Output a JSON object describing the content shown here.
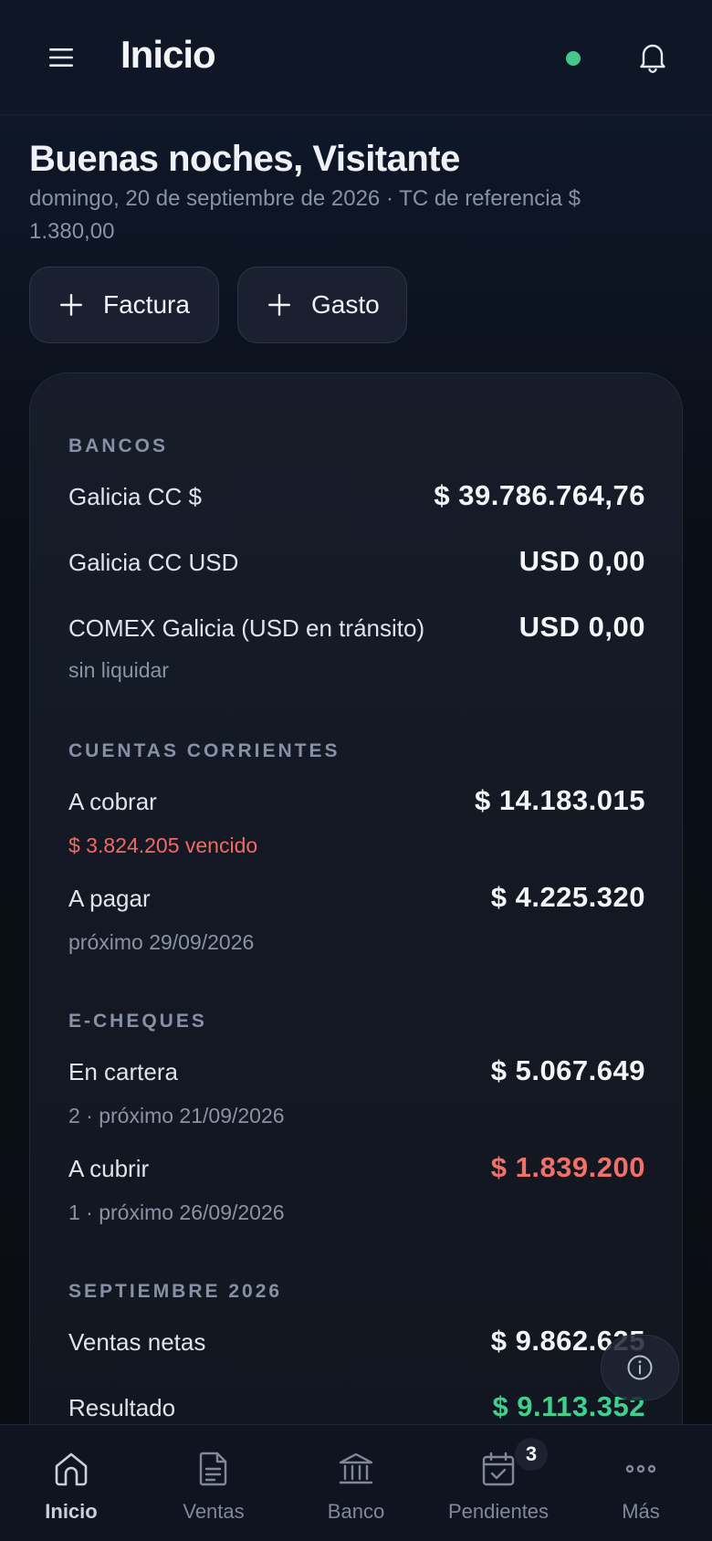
{
  "header": {
    "title": "Inicio",
    "status_color": "#45c78e"
  },
  "greeting": {
    "title": "Buenas noches, Visitante",
    "subtitle": "domingo, 20 de septiembre de 2026 · TC de referencia $ 1.380,00"
  },
  "actions": {
    "factura": "Factura",
    "gasto": "Gasto"
  },
  "summary": {
    "bancos": {
      "heading": "BANCOS",
      "rows": [
        {
          "label": "Galicia CC $",
          "value": "$ 39.786.764,76"
        },
        {
          "label": "Galicia CC USD",
          "value": "USD 0,00"
        },
        {
          "label": "COMEX Galicia (USD en tránsito)",
          "value": "USD 0,00",
          "sub": "sin liquidar"
        }
      ]
    },
    "cuentas": {
      "heading": "CUENTAS CORRIENTES",
      "rows": [
        {
          "label": "A cobrar",
          "value": "$ 14.183.015",
          "sub": "$ 3.824.205 vencido"
        },
        {
          "label": "A pagar",
          "value": "$ 4.225.320",
          "sub": "próximo 29/09/2026"
        }
      ]
    },
    "echeques": {
      "heading": "E-CHEQUES",
      "rows": [
        {
          "label": "En cartera",
          "value": "$ 5.067.649",
          "sub": "2 · próximo 21/09/2026"
        },
        {
          "label": "A cubrir",
          "value": "$ 1.839.200",
          "sub": "1 · próximo 26/09/2026"
        }
      ]
    },
    "mes": {
      "heading": "SEPTIEMBRE 2026",
      "rows": [
        {
          "label": "Ventas netas",
          "value": "$ 9.862.625"
        },
        {
          "label": "Resultado",
          "value": "$ 9.113.352"
        }
      ]
    }
  },
  "colors": {
    "negative": "#f0706a",
    "positive": "#3fcf8e"
  },
  "nav": {
    "items": [
      {
        "label": "Inicio",
        "icon": "home-icon",
        "active": true
      },
      {
        "label": "Ventas",
        "icon": "document-icon"
      },
      {
        "label": "Banco",
        "icon": "bank-icon"
      },
      {
        "label": "Pendientes",
        "icon": "calendar-check-icon",
        "badge": "3"
      },
      {
        "label": "Más",
        "icon": "more-icon"
      }
    ]
  }
}
